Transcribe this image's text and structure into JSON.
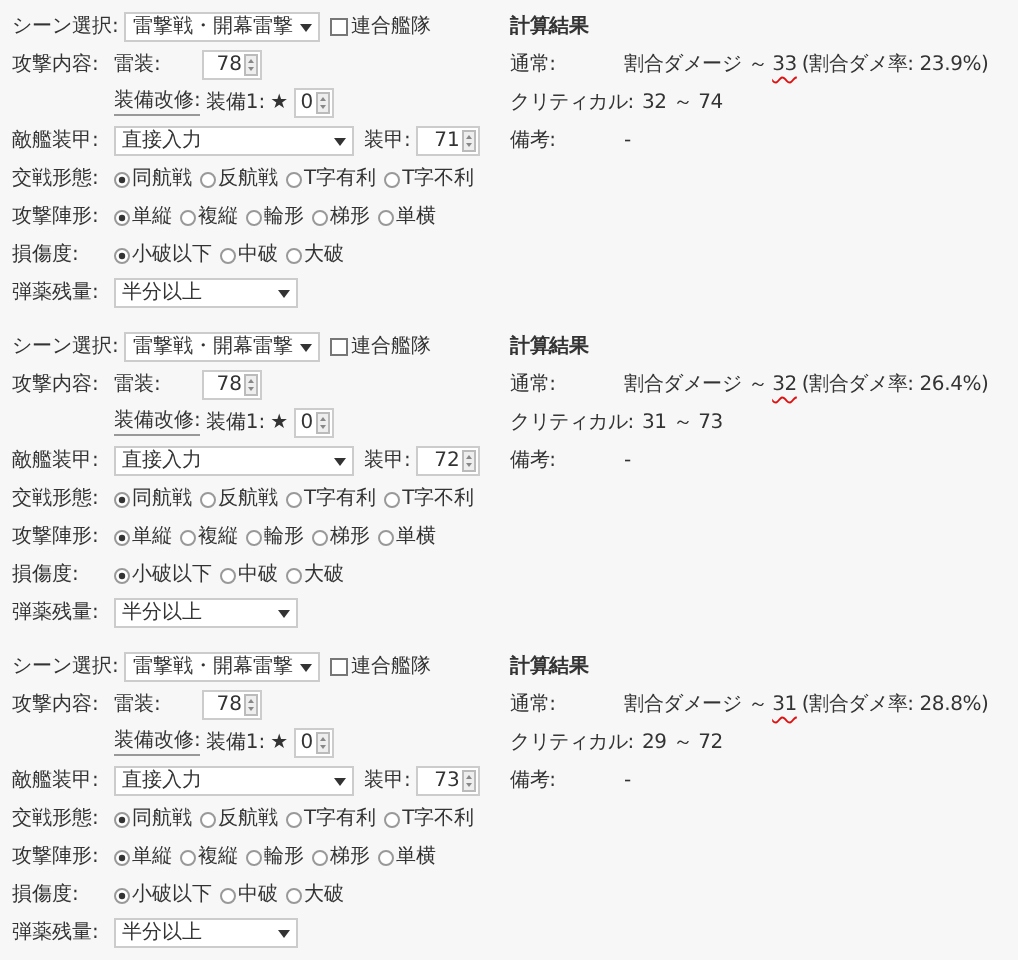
{
  "panels": [
    {
      "form": [
        {
          "kind": "scene",
          "label": "シーン選択:",
          "value": "雷撃戦・開幕雷撃",
          "checkbox": {
            "label": "連合艦隊",
            "checked": false
          }
        },
        {
          "kind": "attack",
          "label": "攻撃内容:",
          "field_label": "雷装:",
          "value": "78"
        },
        {
          "kind": "improve",
          "link": "装備改修:",
          "field_label": "装備1:",
          "star": "★",
          "value": "0"
        },
        {
          "kind": "armor",
          "label": "敵艦装甲:",
          "value": "直接入力",
          "field_label": "装甲:",
          "field_value": "71"
        },
        {
          "kind": "radio",
          "label": "交戦形態:",
          "options": [
            {
              "label": "同航戦",
              "selected": true
            },
            {
              "label": "反航戦",
              "selected": false
            },
            {
              "label": "T字有利",
              "selected": false
            },
            {
              "label": "T字不利",
              "selected": false
            }
          ]
        },
        {
          "kind": "radio",
          "label": "攻撃陣形:",
          "options": [
            {
              "label": "単縦",
              "selected": true
            },
            {
              "label": "複縦",
              "selected": false
            },
            {
              "label": "輪形",
              "selected": false
            },
            {
              "label": "梯形",
              "selected": false
            },
            {
              "label": "単横",
              "selected": false
            }
          ]
        },
        {
          "kind": "radio",
          "label": "損傷度:",
          "options": [
            {
              "label": "小破以下",
              "selected": true
            },
            {
              "label": "中破",
              "selected": false
            },
            {
              "label": "大破",
              "selected": false
            }
          ]
        },
        {
          "kind": "select",
          "label": "弾薬残量:",
          "value": "半分以上"
        }
      ],
      "result": {
        "title": "計算結果",
        "normal": {
          "label": "通常:",
          "prefix": "割合ダメージ ～",
          "value": "33",
          "rate": "(割合ダメ率: 23.9%)"
        },
        "critical": {
          "label": "クリティカル:",
          "value": "32 ～ 74"
        },
        "note": {
          "label": "備考:",
          "value": "-"
        }
      }
    },
    {
      "form": [
        {
          "kind": "scene",
          "label": "シーン選択:",
          "value": "雷撃戦・開幕雷撃",
          "checkbox": {
            "label": "連合艦隊",
            "checked": false
          }
        },
        {
          "kind": "attack",
          "label": "攻撃内容:",
          "field_label": "雷装:",
          "value": "78"
        },
        {
          "kind": "improve",
          "link": "装備改修:",
          "field_label": "装備1:",
          "star": "★",
          "value": "0"
        },
        {
          "kind": "armor",
          "label": "敵艦装甲:",
          "value": "直接入力",
          "field_label": "装甲:",
          "field_value": "72"
        },
        {
          "kind": "radio",
          "label": "交戦形態:",
          "options": [
            {
              "label": "同航戦",
              "selected": true
            },
            {
              "label": "反航戦",
              "selected": false
            },
            {
              "label": "T字有利",
              "selected": false
            },
            {
              "label": "T字不利",
              "selected": false
            }
          ]
        },
        {
          "kind": "radio",
          "label": "攻撃陣形:",
          "options": [
            {
              "label": "単縦",
              "selected": true
            },
            {
              "label": "複縦",
              "selected": false
            },
            {
              "label": "輪形",
              "selected": false
            },
            {
              "label": "梯形",
              "selected": false
            },
            {
              "label": "単横",
              "selected": false
            }
          ]
        },
        {
          "kind": "radio",
          "label": "損傷度:",
          "options": [
            {
              "label": "小破以下",
              "selected": true
            },
            {
              "label": "中破",
              "selected": false
            },
            {
              "label": "大破",
              "selected": false
            }
          ]
        },
        {
          "kind": "select",
          "label": "弾薬残量:",
          "value": "半分以上"
        }
      ],
      "result": {
        "title": "計算結果",
        "normal": {
          "label": "通常:",
          "prefix": "割合ダメージ ～",
          "value": "32",
          "rate": "(割合ダメ率: 26.4%)"
        },
        "critical": {
          "label": "クリティカル:",
          "value": "31 ～ 73"
        },
        "note": {
          "label": "備考:",
          "value": "-"
        }
      }
    },
    {
      "form": [
        {
          "kind": "scene",
          "label": "シーン選択:",
          "value": "雷撃戦・開幕雷撃",
          "checkbox": {
            "label": "連合艦隊",
            "checked": false
          }
        },
        {
          "kind": "attack",
          "label": "攻撃内容:",
          "field_label": "雷装:",
          "value": "78"
        },
        {
          "kind": "improve",
          "link": "装備改修:",
          "field_label": "装備1:",
          "star": "★",
          "value": "0"
        },
        {
          "kind": "armor",
          "label": "敵艦装甲:",
          "value": "直接入力",
          "field_label": "装甲:",
          "field_value": "73"
        },
        {
          "kind": "radio",
          "label": "交戦形態:",
          "options": [
            {
              "label": "同航戦",
              "selected": true
            },
            {
              "label": "反航戦",
              "selected": false
            },
            {
              "label": "T字有利",
              "selected": false
            },
            {
              "label": "T字不利",
              "selected": false
            }
          ]
        },
        {
          "kind": "radio",
          "label": "攻撃陣形:",
          "options": [
            {
              "label": "単縦",
              "selected": true
            },
            {
              "label": "複縦",
              "selected": false
            },
            {
              "label": "輪形",
              "selected": false
            },
            {
              "label": "梯形",
              "selected": false
            },
            {
              "label": "単横",
              "selected": false
            }
          ]
        },
        {
          "kind": "radio",
          "label": "損傷度:",
          "options": [
            {
              "label": "小破以下",
              "selected": true
            },
            {
              "label": "中破",
              "selected": false
            },
            {
              "label": "大破",
              "selected": false
            }
          ]
        },
        {
          "kind": "select",
          "label": "弾薬残量:",
          "value": "半分以上"
        }
      ],
      "result": {
        "title": "計算結果",
        "normal": {
          "label": "通常:",
          "prefix": "割合ダメージ ～",
          "value": "31",
          "rate": "(割合ダメ率: 28.8%)"
        },
        "critical": {
          "label": "クリティカル:",
          "value": "29 ～ 72"
        },
        "note": {
          "label": "備考:",
          "value": "-"
        }
      }
    }
  ]
}
